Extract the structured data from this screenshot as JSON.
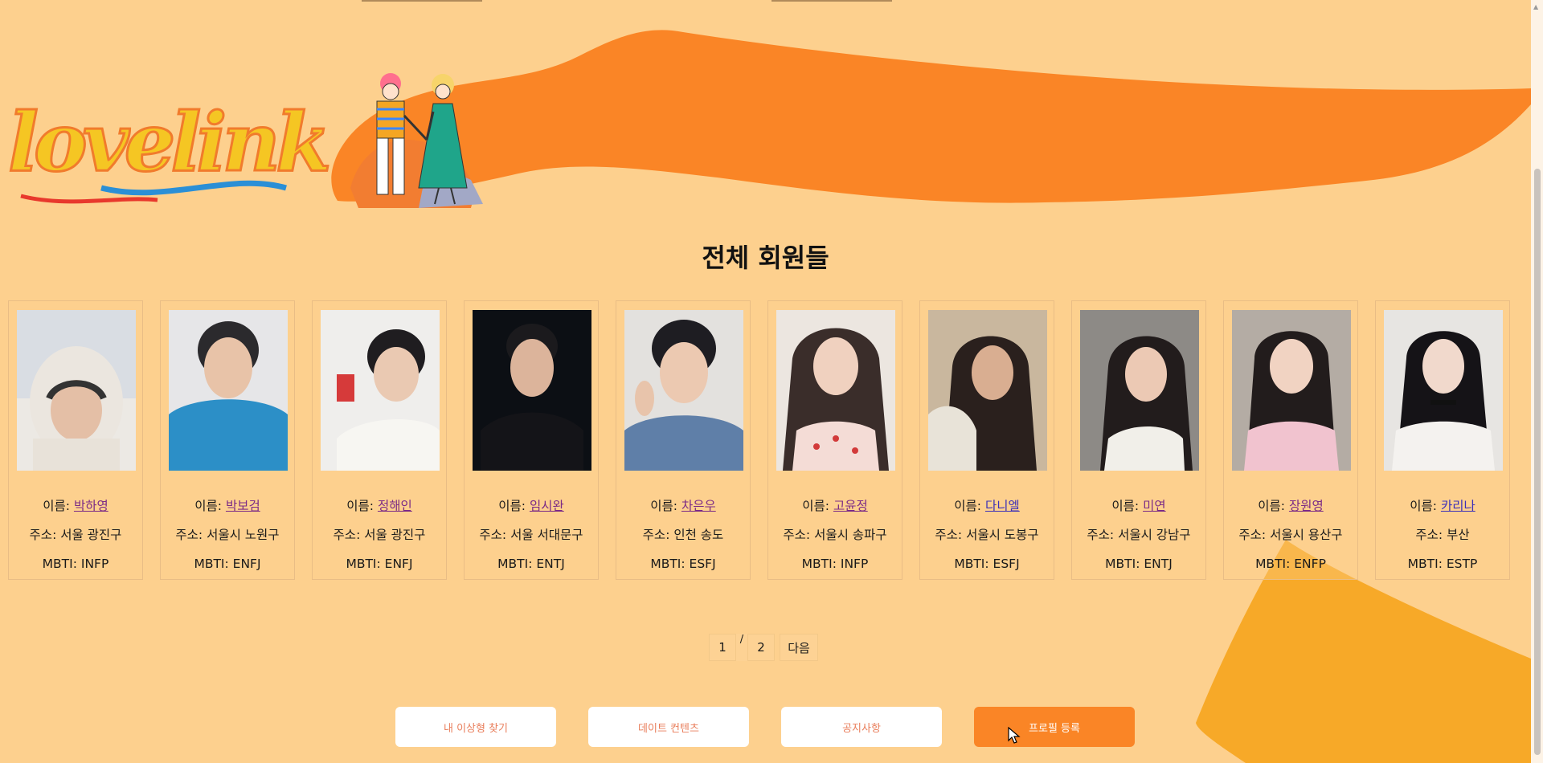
{
  "brand": {
    "logo_text": "lovelink"
  },
  "section_title": "전체 회원들",
  "labels": {
    "name": "이름: ",
    "address": "주소: ",
    "mbti": "MBTI: "
  },
  "members": [
    {
      "name": "박하영",
      "address": "서울 광진구",
      "mbti": "INFP"
    },
    {
      "name": "박보검",
      "address": "서울시 노원구",
      "mbti": "ENFJ"
    },
    {
      "name": "정해인",
      "address": "서울 광진구",
      "mbti": "ENFJ"
    },
    {
      "name": "임시완",
      "address": "서울 서대문구",
      "mbti": "ENTJ"
    },
    {
      "name": "차은우",
      "address": "인천 송도",
      "mbti": "ESFJ"
    },
    {
      "name": "고윤정",
      "address": "서울시 송파구",
      "mbti": "INFP"
    },
    {
      "name": "다니엘",
      "address": "서울시 도봉구",
      "mbti": "ESFJ"
    },
    {
      "name": "미연",
      "address": "서울시 강남구",
      "mbti": "ENTJ"
    },
    {
      "name": "장원영",
      "address": "서울시 용산구",
      "mbti": "ENFP"
    },
    {
      "name": "카리나",
      "address": "부산",
      "mbti": "ESTP"
    }
  ],
  "pagination": {
    "page1": "1",
    "separator": "/",
    "page2": "2",
    "next": "다음"
  },
  "menu": {
    "find_ideal": "내 이상형 찾기",
    "date_content": "데이트 컨텐츠",
    "notice": "공지사항",
    "profile_register": "프로필 등록"
  },
  "colors": {
    "background": "#fdd08e",
    "orange_accent": "#fa8526",
    "shape_yellow": "#f7a928",
    "link": "#7b2a86",
    "button_text": "#e97e5b"
  },
  "icons": {
    "cursor": "mouse-pointer-icon",
    "scroll_up": "scroll-up-arrow-icon"
  }
}
